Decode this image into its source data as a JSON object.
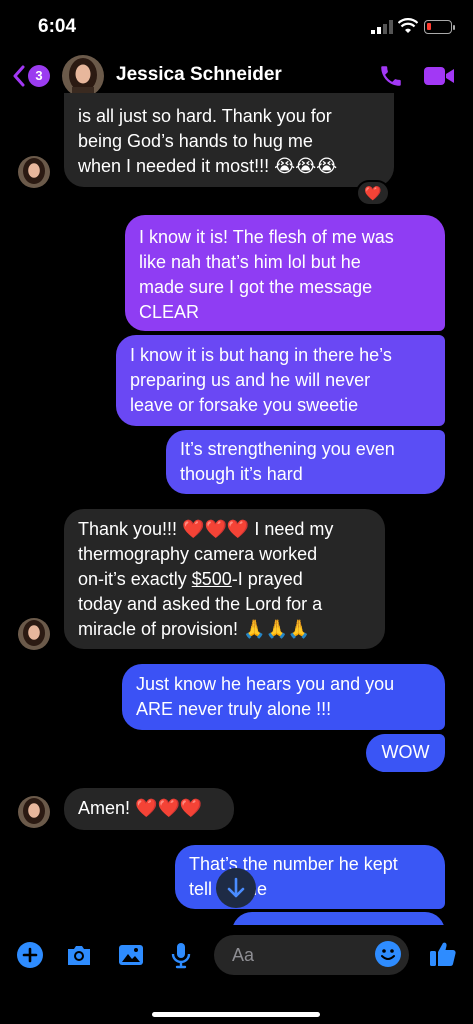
{
  "status": {
    "time": "6:04"
  },
  "header": {
    "badge": "3",
    "contact_name": "Jessica Schneider"
  },
  "messages": [
    {
      "dir": "in",
      "lines": [
        "is all just so hard. Thank you for",
        "being God’s hands to hug me",
        "when I needed it most!!! 😭😭😭"
      ],
      "reaction": "❤️"
    },
    {
      "dir": "out",
      "lines": [
        "I know it is! The flesh of me was",
        "like nah that’s him lol but he",
        "made sure I got the message",
        "CLEAR"
      ]
    },
    {
      "dir": "out",
      "lines": [
        "I know it is but hang in there he’s",
        "preparing us and he will never",
        "leave or forsake you sweetie"
      ]
    },
    {
      "dir": "out",
      "lines": [
        "It’s strengthening you even",
        "though it’s hard"
      ]
    },
    {
      "dir": "in",
      "line1_text": "Thank you!!!",
      "line1_hearts": "❤️❤️❤️",
      "line1_end": "I need my",
      "line2": "thermography camera worked",
      "line3_pre": "on-it’s exactly ",
      "line3_amount": "$500",
      "line3_post": "-I prayed",
      "line4": "today and asked the Lord for a",
      "line5": "miracle of provision! 🙏🙏🙏"
    },
    {
      "dir": "out",
      "lines": [
        "Just know he hears you and you",
        "ARE never truly alone !!!"
      ]
    },
    {
      "dir": "out",
      "text": "WOW"
    },
    {
      "dir": "in",
      "text": "Amen!",
      "hearts": "❤️❤️❤️"
    },
    {
      "dir": "out",
      "lines": [
        "That’s the number he kept",
        "tell",
        "me"
      ]
    }
  ],
  "composer": {
    "placeholder": "Aa"
  },
  "colors": {
    "accent": "#a238f5",
    "outgoing_top": "#9d39f0",
    "outgoing_bottom": "#3b52f5",
    "incoming": "#262626"
  },
  "icons": [
    "plus-circle-icon",
    "camera-icon",
    "image-icon",
    "microphone-icon",
    "emoji-icon",
    "thumbs-up-icon",
    "phone-icon",
    "video-icon",
    "chevron-left-icon",
    "arrow-down-icon"
  ]
}
